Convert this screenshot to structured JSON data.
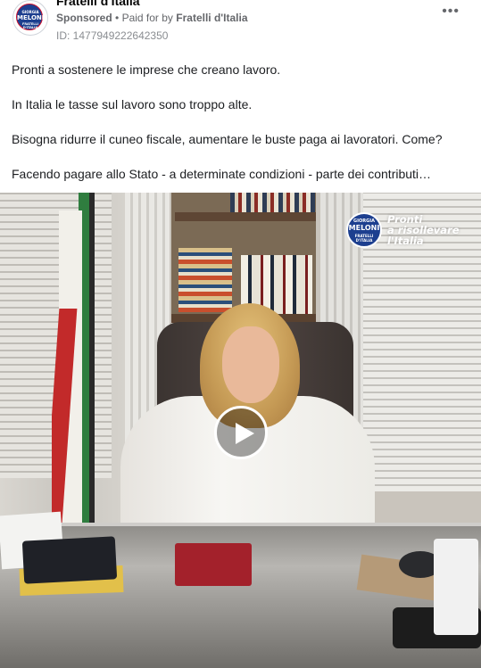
{
  "post": {
    "page_name": "Fratelli d'Italia",
    "sponsored": "Sponsored",
    "separator": "•",
    "paid_for_prefix": "Paid for by",
    "paid_for_by": "Fratelli d'Italia",
    "ad_id": "ID: 1477949222642350",
    "more_icon": "more-options-icon",
    "avatar_logo": {
      "line1": "GIORGIA",
      "line2": "MELONI",
      "line3": "FRATELLI D'ITALIA"
    }
  },
  "body": {
    "paragraphs": [
      "Pronti a sostenere le imprese che creano lavoro.",
      "In Italia le tasse sul lavoro sono troppo alte.",
      "Bisogna ridurre il cuneo fiscale, aumentare le buste paga ai lavoratori. Come?",
      "Facendo pagare allo Stato - a determinate condizioni - parte dei contributi…"
    ]
  },
  "video": {
    "logo": {
      "line1": "GIORGIA",
      "line2": "MELONI",
      "line3": "FRATELLI D'ITALIA"
    },
    "slogan": [
      "Pronti",
      "a risollevare",
      "l'Italia"
    ],
    "play_icon": "play-icon",
    "colors": {
      "party_blue": "#1d3f8f",
      "party_red": "#c8102e"
    }
  }
}
